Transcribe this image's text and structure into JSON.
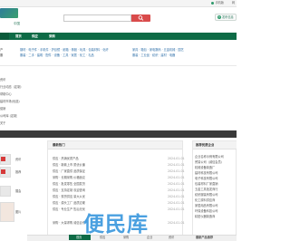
{
  "topbar": {
    "mobile_label": "手机版",
    "extra_label": "网"
  },
  "header": {
    "logo_text": "中国",
    "search_placeholder": "",
    "publish_label": "发布信息"
  },
  "nav": {
    "items": [
      "首页",
      "供应",
      "采购"
    ]
  },
  "categories": {
    "row1_label": "产",
    "row1": "钢材 · 电子件 · 手机件 · 护目镜 · 纸箱 · 橡胶 · 玩具 · 包装材料 · 化纤",
    "row2_label": "服",
    "row2": "服装 · 二手 · 建筑 · 配件 · 设备 · 工具 · 家居 · 化工 · 礼品",
    "right1": "家具 · 箱包 · 家电数码 · 五金机械 · 园艺",
    "right2": "服装 · 工业品 · 纺织 · 建材 · 电器"
  },
  "left_list": [
    "资讯",
    "行业动态（定制）",
    "帮助中心",
    "建材市场(优选)",
    "促销",
    "公司库 (定制)",
    "关于"
  ],
  "middle": {
    "title": "最新热门",
    "rows": [
      {
        "text": "供应 · 热销优质产品",
        "date": "2024-01-01"
      },
      {
        "text": "供应 · 新款上市 质优价廉",
        "date": "2024-01-01"
      },
      {
        "text": "供应 · 厂家直供 品质保证",
        "date": "2024-01-01"
      },
      {
        "text": "采购 · 长期采购 价格面议",
        "date": "2024-01-01"
      },
      {
        "text": "供应 · 批发零售 全国发货",
        "date": "2024-01-01"
      },
      {
        "text": "供应 · 支持定制 欢迎咨询",
        "date": "2024-01-01"
      },
      {
        "text": "供应 · 现货供应 量大从优",
        "date": "2024-01-01"
      },
      {
        "text": "供应 · 源头工厂 品质过硬",
        "date": "2024-01-01"
      },
      {
        "text": "供应 · 专业生产 售后无忧",
        "date": "2024-01-01"
      },
      {
        "text": "采购 · 大量求购 诚信合作",
        "date": "2024-01-01"
      }
    ]
  },
  "right": {
    "title": "推荐优质企业",
    "rows": [
      "企业名称示例有限公司",
      "贸易公司（诚信会员）",
      "机械设备制造厂",
      "建材科技有限公司",
      "电子科技有限公司",
      "包装材料厂家直销",
      "五金工具批发商行",
      "纺织服装有限公司",
      "化工原料供应商",
      "家居用品有限公司",
      "环保设备科技公司",
      "精密仪器制造商"
    ]
  },
  "thumbs": [
    {
      "label": "资讯"
    },
    {
      "label": "推荐"
    },
    {
      "label": "展会"
    },
    {
      "label": "图片"
    }
  ],
  "bottom_nav": [
    "首页",
    "供应",
    "采购",
    "企业",
    "资讯",
    "分类",
    "会员",
    "帮助",
    "关于"
  ],
  "bottom_right_label": "最新产品推荐",
  "watermark": "便民库",
  "colors": {
    "nav_green": "#0e6b46",
    "accent_red": "#d94b4b",
    "watermark_blue": "#4aa0e0"
  }
}
